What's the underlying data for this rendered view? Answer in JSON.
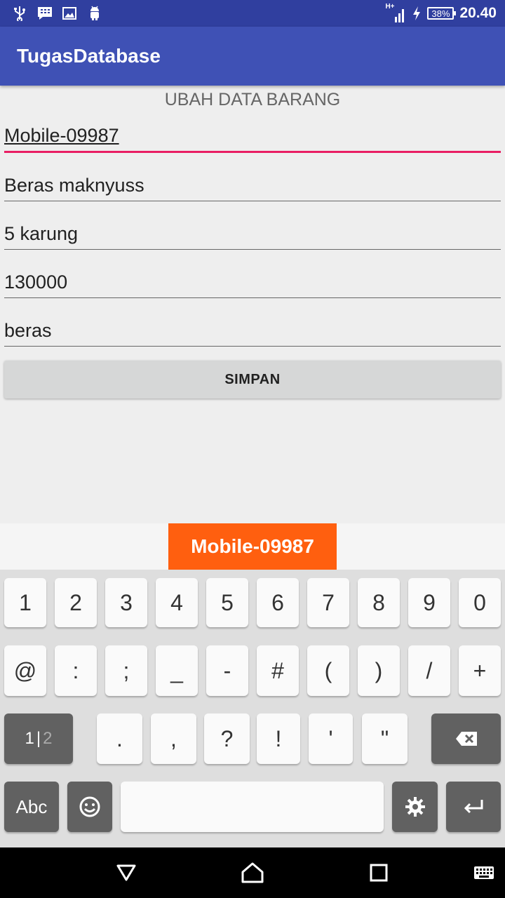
{
  "status_bar": {
    "battery": "38%",
    "time": "20.40",
    "network": "H+"
  },
  "app": {
    "title": "TugasDatabase"
  },
  "form": {
    "title": "UBAH DATA BARANG",
    "fields": [
      {
        "value": "Mobile-09987"
      },
      {
        "value": "Beras maknyuss"
      },
      {
        "value": "5 karung"
      },
      {
        "value": "130000"
      },
      {
        "value": "beras"
      }
    ],
    "save_label": "SIMPAN"
  },
  "suggestion": "Mobile-09987",
  "keyboard": {
    "row1": [
      "1",
      "2",
      "3",
      "4",
      "5",
      "6",
      "7",
      "8",
      "9",
      "0"
    ],
    "row2": [
      "@",
      ":",
      ";",
      "_",
      "-",
      "#",
      "(",
      ")",
      "/",
      "+"
    ],
    "row3": [
      ".",
      ",",
      "?",
      "!",
      "'",
      "\""
    ],
    "mode_primary": "1",
    "mode_sep": "|",
    "mode_secondary": "2",
    "abc_label": "Abc"
  },
  "colors": {
    "status_bar": "#303f9f",
    "app_bar": "#3f51b5",
    "accent": "#e91e63",
    "suggestion": "#ff5f0f"
  }
}
